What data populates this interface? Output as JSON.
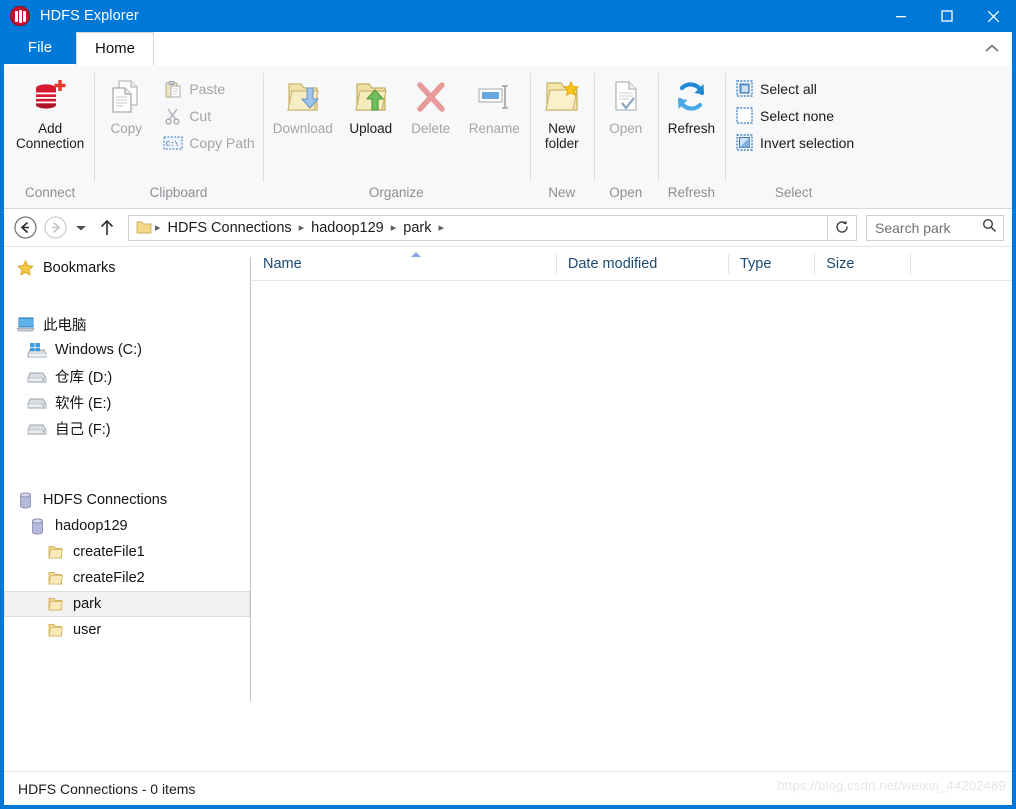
{
  "window": {
    "title": "HDFS Explorer",
    "logo_icon": "hdfs-app-icon",
    "controls": {
      "minimize": "minimize-icon",
      "maximize": "maximize-icon",
      "close": "close-icon"
    }
  },
  "tabs": [
    {
      "label": "File",
      "active": false
    },
    {
      "label": "Home",
      "active": true
    }
  ],
  "ribbon": {
    "collapse_icon": "chevron-up-icon",
    "groups": [
      {
        "label": "Connect",
        "buttons": [
          {
            "label": "Add\nConnection",
            "label_line1": "Add",
            "label_line2": "Connection",
            "icon": "add-connection-icon",
            "enabled": true
          }
        ]
      },
      {
        "label": "Clipboard",
        "buttons": [
          {
            "label": "Copy",
            "icon": "copy-icon",
            "enabled": false
          }
        ],
        "small_buttons": [
          {
            "label": "Paste",
            "icon": "paste-icon",
            "enabled": false
          },
          {
            "label": "Cut",
            "icon": "cut-icon",
            "enabled": false
          },
          {
            "label": "Copy Path",
            "icon": "copy-path-icon",
            "enabled": false
          }
        ]
      },
      {
        "label": "Organize",
        "buttons": [
          {
            "label": "Download",
            "icon": "download-folder-icon",
            "enabled": false
          },
          {
            "label": "Upload",
            "icon": "upload-folder-icon",
            "enabled": true
          },
          {
            "label": "Delete",
            "icon": "delete-icon",
            "enabled": false
          },
          {
            "label": "Rename",
            "icon": "rename-icon",
            "enabled": false
          }
        ]
      },
      {
        "label": "New",
        "buttons": [
          {
            "label": "New folder",
            "label_line1": "New",
            "label_line2": "folder",
            "icon": "new-folder-icon",
            "enabled": true
          }
        ]
      },
      {
        "label": "Open",
        "buttons": [
          {
            "label": "Open",
            "icon": "open-file-icon",
            "enabled": false
          }
        ]
      },
      {
        "label": "Refresh",
        "buttons": [
          {
            "label": "Refresh",
            "icon": "refresh-icon",
            "enabled": true
          }
        ]
      },
      {
        "label": "Select",
        "small_buttons": [
          {
            "label": "Select all",
            "icon": "select-all-icon",
            "enabled": true
          },
          {
            "label": "Select none",
            "icon": "select-none-icon",
            "enabled": true
          },
          {
            "label": "Invert selection",
            "icon": "invert-selection-icon",
            "enabled": true
          }
        ]
      }
    ]
  },
  "address_bar": {
    "back_icon": "back-arrow-icon",
    "forward_icon": "forward-arrow-icon",
    "history_icon": "chevron-down-icon",
    "up_icon": "up-arrow-icon",
    "folder_icon": "folder-icon",
    "breadcrumbs": [
      "HDFS Connections",
      "hadoop129",
      "park"
    ],
    "separator": "▸",
    "refresh_icon": "refresh-address-icon",
    "search": {
      "placeholder": "Search park",
      "icon": "search-icon",
      "value": ""
    }
  },
  "sidebar": {
    "bookmarks": {
      "label": "Bookmarks",
      "icon": "star-icon"
    },
    "this_pc": {
      "label": "此电脑",
      "icon": "computer-icon"
    },
    "drives": [
      {
        "label": "Windows (C:)",
        "icon": "windows-drive-icon"
      },
      {
        "label": "仓库 (D:)",
        "icon": "drive-icon"
      },
      {
        "label": "软件 (E:)",
        "icon": "drive-icon"
      },
      {
        "label": "自己 (F:)",
        "icon": "drive-icon"
      }
    ],
    "hdfs_root": {
      "label": "HDFS Connections",
      "icon": "database-icon"
    },
    "connection": {
      "label": "hadoop129",
      "icon": "database-icon"
    },
    "folders": [
      {
        "label": "createFile1",
        "icon": "folder-icon",
        "selected": false
      },
      {
        "label": "createFile2",
        "icon": "folder-icon",
        "selected": false
      },
      {
        "label": "park",
        "icon": "folder-icon",
        "selected": true
      },
      {
        "label": "user",
        "icon": "folder-icon",
        "selected": false
      }
    ]
  },
  "file_list": {
    "columns": [
      {
        "label": "Name",
        "sorted": "asc"
      },
      {
        "label": "Date modified",
        "sorted": ""
      },
      {
        "label": "Type",
        "sorted": ""
      },
      {
        "label": "Size",
        "sorted": ""
      }
    ],
    "rows": []
  },
  "status_bar": {
    "text": "HDFS Connections - 0 items",
    "watermark": "https://blog.csdn.net/weixin_44202489"
  },
  "colors": {
    "accent": "#0078d7",
    "title_bar": "#0078d7",
    "ribbon_bg": "#f7f8f9",
    "disabled_text": "#a3a5a8",
    "column_header_text": "#1c4a73",
    "selection_bg": "#f2f2f2"
  }
}
